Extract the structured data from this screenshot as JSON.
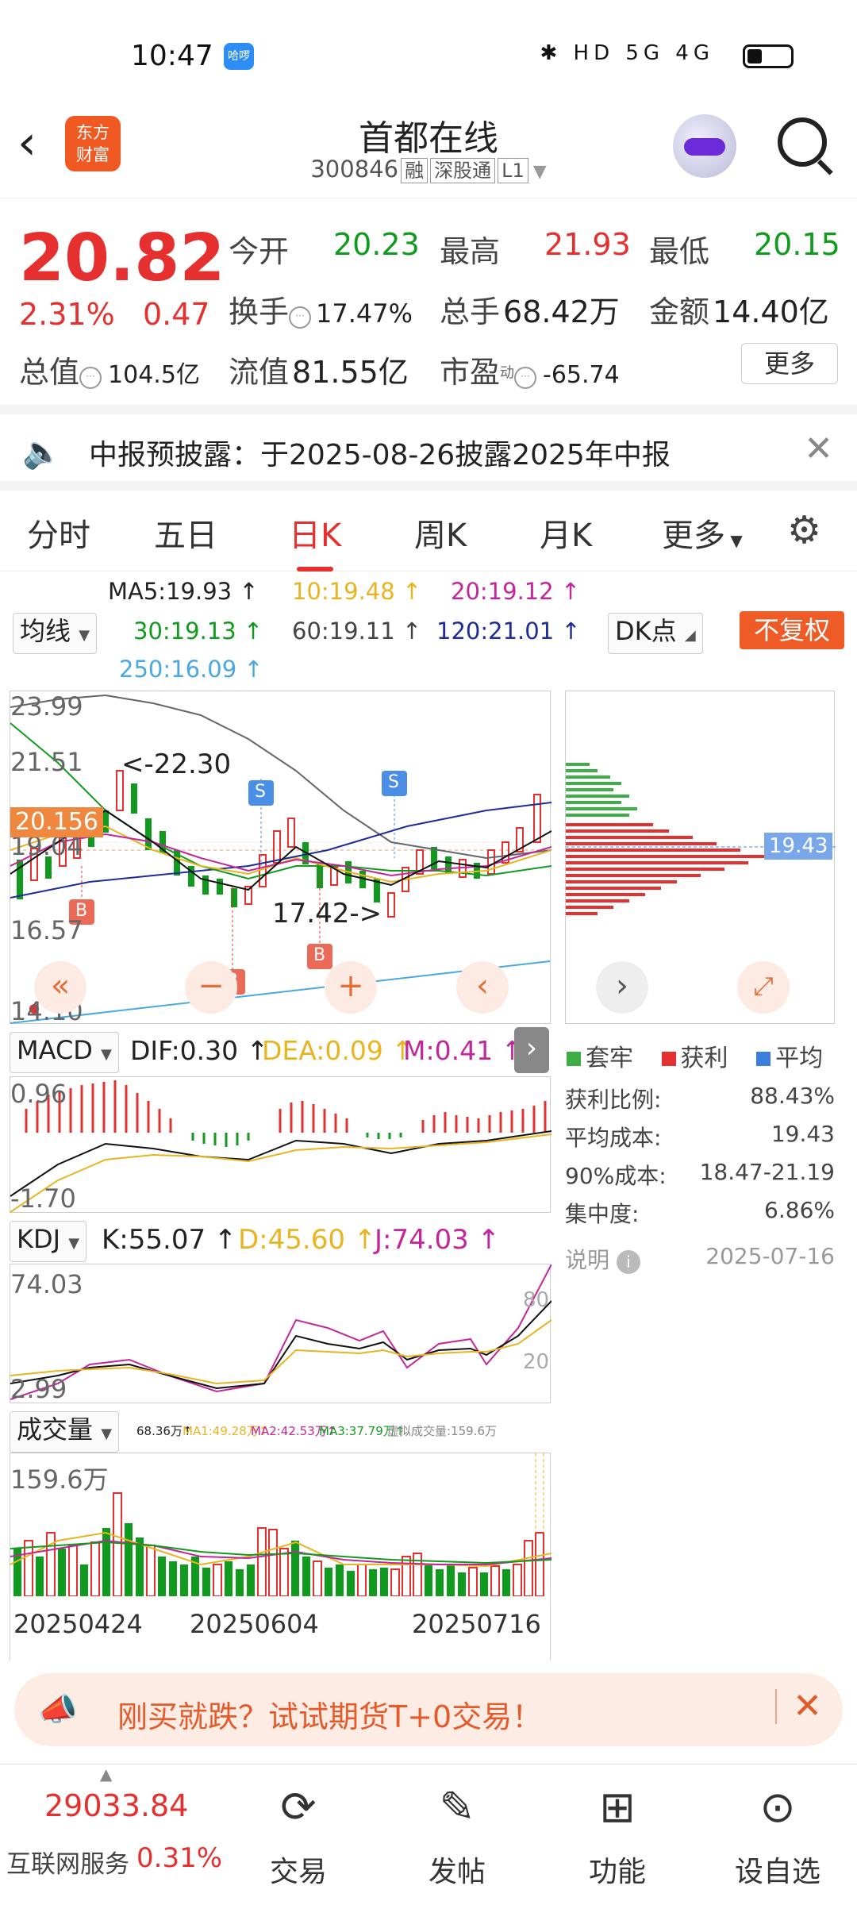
{
  "status_bar": {
    "time": "10:47",
    "badge": "哈啰",
    "icons": "✱ HD 5G 4G"
  },
  "header": {
    "logo": "东方\n财富",
    "title": "首都在线",
    "code": "300846",
    "tags": [
      "融",
      "深股通",
      "L1"
    ]
  },
  "quote": {
    "price": "20.82",
    "change_pct": "2.31%",
    "change_abs": "0.47",
    "open_label": "今开",
    "open": "20.23",
    "high_label": "最高",
    "high": "21.93",
    "low_label": "最低",
    "low": "20.15",
    "turnover_label": "换手",
    "turnover": "17.47%",
    "volume_label": "总手",
    "volume": "68.42万",
    "amount_label": "金额",
    "amount": "14.40亿",
    "mktcap_label": "总值",
    "mktcap": "104.5亿",
    "float_label": "流值",
    "float": "81.55亿",
    "pe_label": "市盈",
    "pe_sup": "动",
    "pe": "-65.74",
    "more": "更多"
  },
  "notice": {
    "text": "中报预披露：于2025-08-26披露2025年中报"
  },
  "tabs": [
    "分时",
    "五日",
    "日K",
    "周K",
    "月K",
    "更多"
  ],
  "active_tab": "日K",
  "ma": {
    "selector": "均线",
    "ma5": "MA5:19.93",
    "ma10": "10:19.48",
    "ma20": "20:19.12",
    "ma30": "30:19.13",
    "ma60": "60:19.11",
    "ma120": "120:21.01",
    "ma250": "250:16.09",
    "dk": "DK点",
    "fq": "不复权"
  },
  "kline": {
    "y_labels": [
      "23.99",
      "21.51",
      "19.04",
      "16.57",
      "14.10"
    ],
    "current_price_tag": "20.156",
    "annotations": {
      "high": "<-22.30",
      "low": "17.42->"
    },
    "signals": [
      "B",
      "B",
      "B",
      "S",
      "S"
    ]
  },
  "macd": {
    "selector": "MACD",
    "dif": "DIF:0.30",
    "dea": "DEA:0.09",
    "m": "M:0.41",
    "y_top": "0.96",
    "y_bottom": "-1.70"
  },
  "kdj": {
    "selector": "KDJ",
    "k": "K:55.07",
    "d": "D:45.60",
    "j": "J:74.03",
    "y_top": "74.03",
    "y_bottom": "2.99",
    "level_80": "80",
    "level_20": "20"
  },
  "volume": {
    "selector": "成交量",
    "current": "68.36万",
    "ma1": "MA1:49.28万",
    "ma2": "MA2:42.53万",
    "ma3": "MA3:37.79万",
    "virtual": "虚拟成交量:159.6万",
    "y_top": "159.6万",
    "dates": [
      "20250424",
      "20250604",
      "20250716"
    ]
  },
  "chips": {
    "avg_tag": "19.43",
    "legend": [
      "套牢",
      "获利",
      "平均"
    ],
    "rows": [
      {
        "label": "获利比例:",
        "value": "88.43%"
      },
      {
        "label": "平均成本:",
        "value": "19.43"
      },
      {
        "label": "90%成本:",
        "value": "18.47-21.19"
      },
      {
        "label": "集中度:",
        "value": "6.86%"
      }
    ],
    "note_label": "说明",
    "date": "2025-07-16"
  },
  "ad": {
    "text": "刚买就跌？试试期货T+0交易！"
  },
  "nav": {
    "index_value": "29033.84",
    "index_name": "互联网服务",
    "index_pct": "0.31%",
    "items": [
      "交易",
      "发帖",
      "功能",
      "设自选"
    ]
  },
  "colors": {
    "up": "#e5302f",
    "down": "#119b1e",
    "accent": "#ef5b26"
  }
}
